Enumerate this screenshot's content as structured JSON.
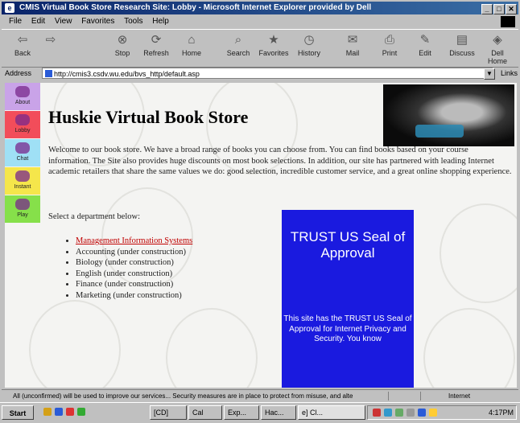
{
  "window": {
    "title": "CMIS Virtual Book Store Research Site: Lobby - Microsoft Internet Explorer provided by Dell",
    "controls": [
      "_",
      "□",
      "✕"
    ]
  },
  "menu": [
    "File",
    "Edit",
    "View",
    "Favorites",
    "Tools",
    "Help"
  ],
  "toolbar": {
    "back": "Back",
    "forward": "",
    "stop": "Stop",
    "refresh": "Refresh",
    "home": "Home",
    "search": "Search",
    "favorites": "Favorites",
    "history": "History",
    "mail": "Mail",
    "print": "Print",
    "edit": "Edit",
    "discuss": "Discuss",
    "dell_home": "Dell Home"
  },
  "address": {
    "label": "Address",
    "url": "http://cmis3.csdv.wu.edu/bvs_http/default.asp",
    "links": "Links"
  },
  "nav": [
    {
      "label": "About",
      "color": "#c9a3e8"
    },
    {
      "label": "Lobby",
      "color": "#f24d5a"
    },
    {
      "label": "Chat",
      "color": "#9fe0f5"
    },
    {
      "label": "Instant",
      "color": "#f5e64b"
    },
    {
      "label": "Play",
      "color": "#86e04a"
    }
  ],
  "page": {
    "title": "Huskie Virtual Book Store",
    "welcome": "Welcome to our book store. We have a broad range of books you can choose from. You can find books based on your course information. The Site also provides huge discounts on most book selections. In addition, our site has partnered with leading Internet academic retailers that share the same values we do: good selection, incredible customer service, and a great online shopping experience.",
    "select_prompt": "Select a department below:",
    "departments": [
      "Management Information Systems",
      "Accounting (under construction)",
      "Biology (under construction)",
      "English (under construction)",
      "Finance (under construction)",
      "Marketing (under construction)"
    ]
  },
  "trust": {
    "heading": "TRUST US Seal of Approval",
    "body": "This site has the TRUST US Seal of Approval for Internet Privacy and Security. You know"
  },
  "status": {
    "text": "All (unconfirmed) will be used to improve our services...   Security measures are in place to protect from misuse, and alte",
    "zone": "Internet"
  },
  "taskbar": {
    "start": "Start",
    "tasks": [
      "[CD]",
      "Cal",
      "Exp...",
      "Hac...",
      "e] Cl..."
    ],
    "clock": "4:17PM"
  }
}
